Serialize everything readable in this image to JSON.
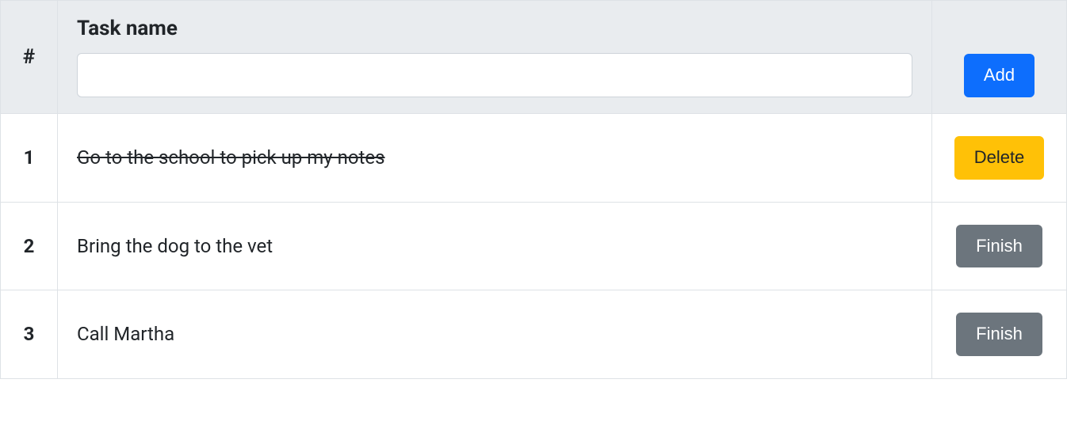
{
  "header": {
    "number_symbol": "#",
    "task_name_label": "Task name",
    "input_value": "",
    "add_button_label": "Add"
  },
  "buttons": {
    "delete_label": "Delete",
    "finish_label": "Finish"
  },
  "tasks": [
    {
      "index": "1",
      "name": "Go to the school to pick up my notes",
      "completed": true
    },
    {
      "index": "2",
      "name": "Bring the dog to the vet",
      "completed": false
    },
    {
      "index": "3",
      "name": "Call Martha",
      "completed": false
    }
  ]
}
